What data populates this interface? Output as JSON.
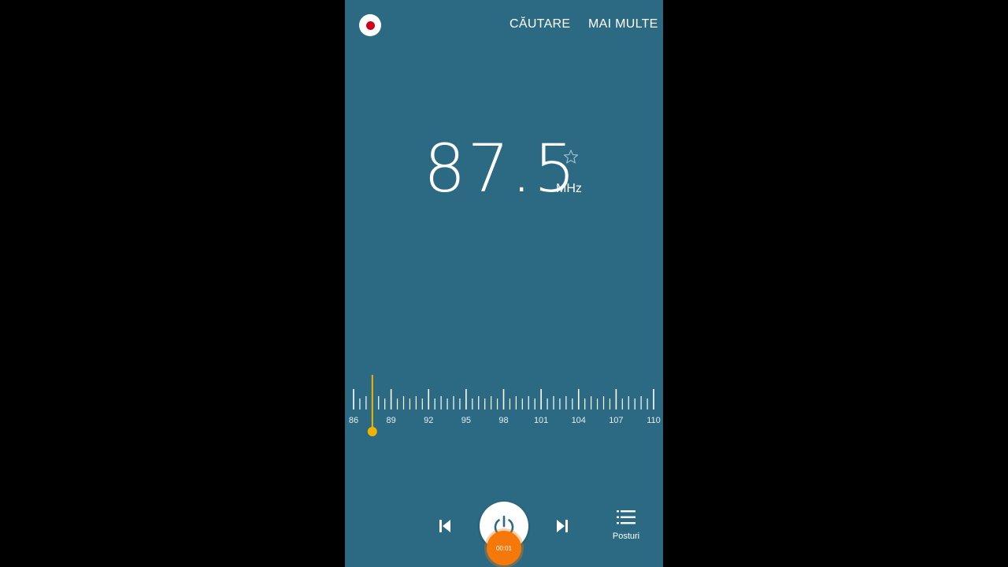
{
  "header": {
    "record_icon": "record-icon",
    "search_label": "CĂUTARE",
    "more_label": "MAI MULTE"
  },
  "tuner": {
    "frequency": "87.5",
    "unit": "MHz",
    "favorite_icon": "star-outline-icon"
  },
  "dial": {
    "min": 86,
    "max": 110,
    "current": 87.5,
    "labels": [
      "86",
      "89",
      "92",
      "95",
      "98",
      "101",
      "104",
      "107",
      "110"
    ],
    "indicator_color": "#f0b400"
  },
  "controls": {
    "prev_icon": "skip-previous-icon",
    "power_icon": "power-icon",
    "next_icon": "skip-next-icon",
    "timer": "00:01",
    "stations_icon": "list-icon",
    "stations_label": "Posturi"
  },
  "colors": {
    "background": "#2b6a82",
    "accent": "#f5780a",
    "record": "#d0021b"
  }
}
